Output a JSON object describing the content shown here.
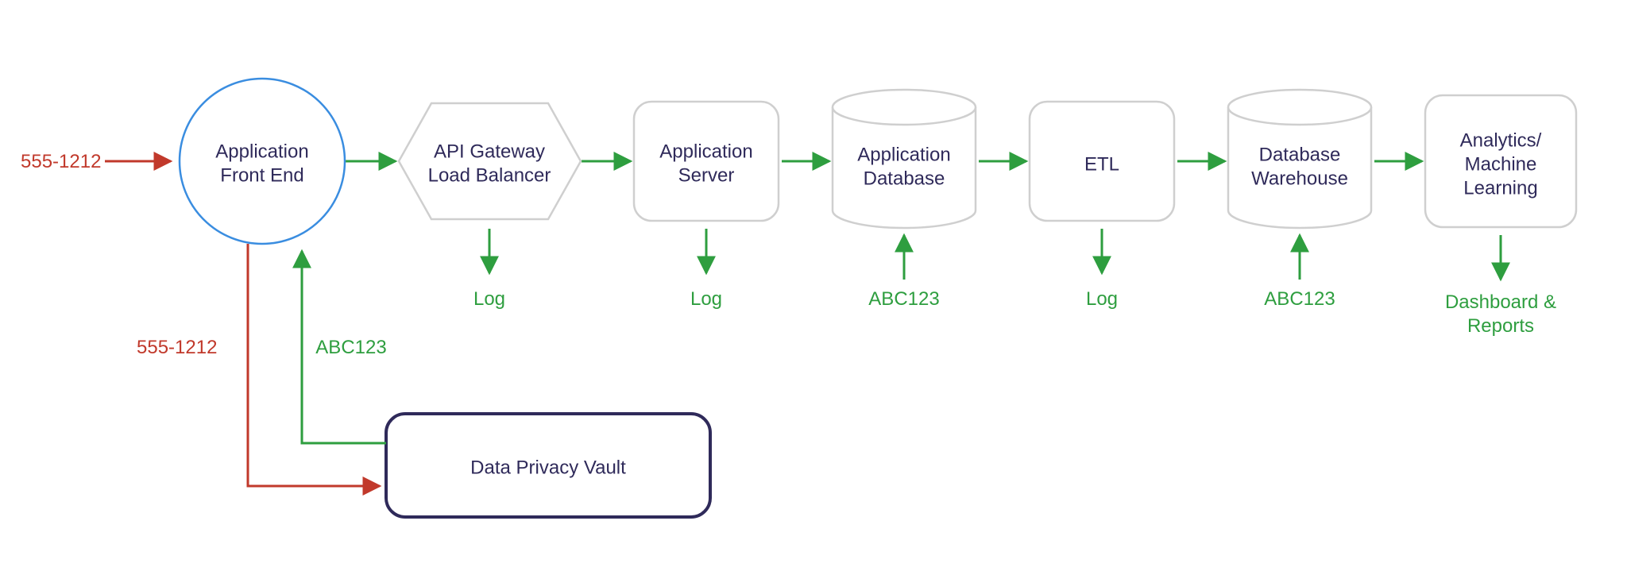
{
  "nodes": {
    "frontend": {
      "line1": "Application",
      "line2": "Front End"
    },
    "gateway": {
      "line1": "API Gateway",
      "line2": "Load Balancer"
    },
    "appserver": {
      "line1": "Application",
      "line2": "Server"
    },
    "appdb": {
      "line1": "Application",
      "line2": "Database"
    },
    "etl": {
      "line1": "ETL"
    },
    "dw": {
      "line1": "Database",
      "line2": "Warehouse"
    },
    "analytics": {
      "line1": "Analytics/",
      "line2": "Machine",
      "line3": "Learning"
    },
    "vault": {
      "label": "Data Privacy Vault"
    }
  },
  "labels": {
    "input_phone": "555-1212",
    "vault_phone": "555-1212",
    "vault_token": "ABC123",
    "log": "Log",
    "token": "ABC123",
    "dash_line1": "Dashboard &",
    "dash_line2": "Reports"
  },
  "colors": {
    "node_stroke": "#cfcfcf",
    "frontend_stroke": "#3a8de0",
    "vault_stroke": "#2f2a5a",
    "green": "#2e9e3f",
    "red": "#c1392b",
    "text": "#2f2a5a"
  }
}
